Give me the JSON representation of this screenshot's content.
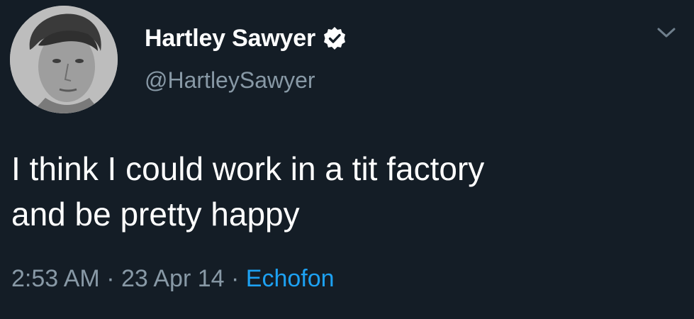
{
  "user": {
    "display_name": "Hartley Sawyer",
    "handle": "@HartleySawyer",
    "verified": true,
    "avatar_icon": "profile-photo"
  },
  "tweet": {
    "text_lines": [
      "I think I could work in a tit factory",
      "and be pretty happy"
    ],
    "time": "2:53 AM",
    "separator": "·",
    "date": "23 Apr 14",
    "source": "Echofon"
  },
  "icons": {
    "verified": "verified-badge-icon",
    "menu": "chevron-down-icon"
  },
  "colors": {
    "background": "#141d26",
    "secondary_text": "#8899a6",
    "link": "#1da1f2"
  }
}
